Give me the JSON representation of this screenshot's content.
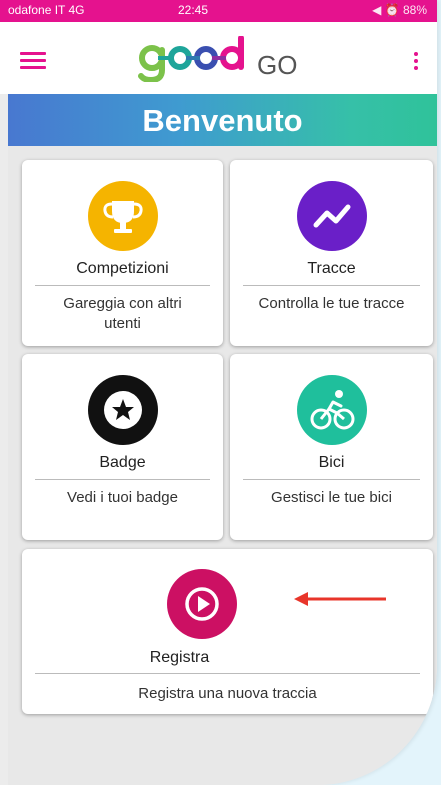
{
  "status_bar": {
    "carrier": "odafone IT  4G",
    "time": "22:45",
    "icons": "◀ ⏰ 88%"
  },
  "app": {
    "logo_text": "GO"
  },
  "banner": {
    "title": "Benvenuto"
  },
  "cards": [
    {
      "title": "Competizioni",
      "desc": "Gareggia con altri utenti",
      "icon": "trophy-icon",
      "color": "#f5b400"
    },
    {
      "title": "Tracce",
      "desc": "Controlla le tue tracce",
      "icon": "chart-line-icon",
      "color": "#6a1fc8"
    },
    {
      "title": "Badge",
      "desc": "Vedi i tuoi badge",
      "icon": "star-badge-icon",
      "color": "#111111"
    },
    {
      "title": "Bici",
      "desc": "Gestisci le tue bici",
      "icon": "bike-icon",
      "color": "#1fbf9c"
    },
    {
      "title": "Registra",
      "desc": "Registra una nuova traccia",
      "icon": "play-icon",
      "color": "#cc1063"
    }
  ],
  "colors": {
    "accent": "#e5128e",
    "annotation_arrow": "#e8352a"
  }
}
